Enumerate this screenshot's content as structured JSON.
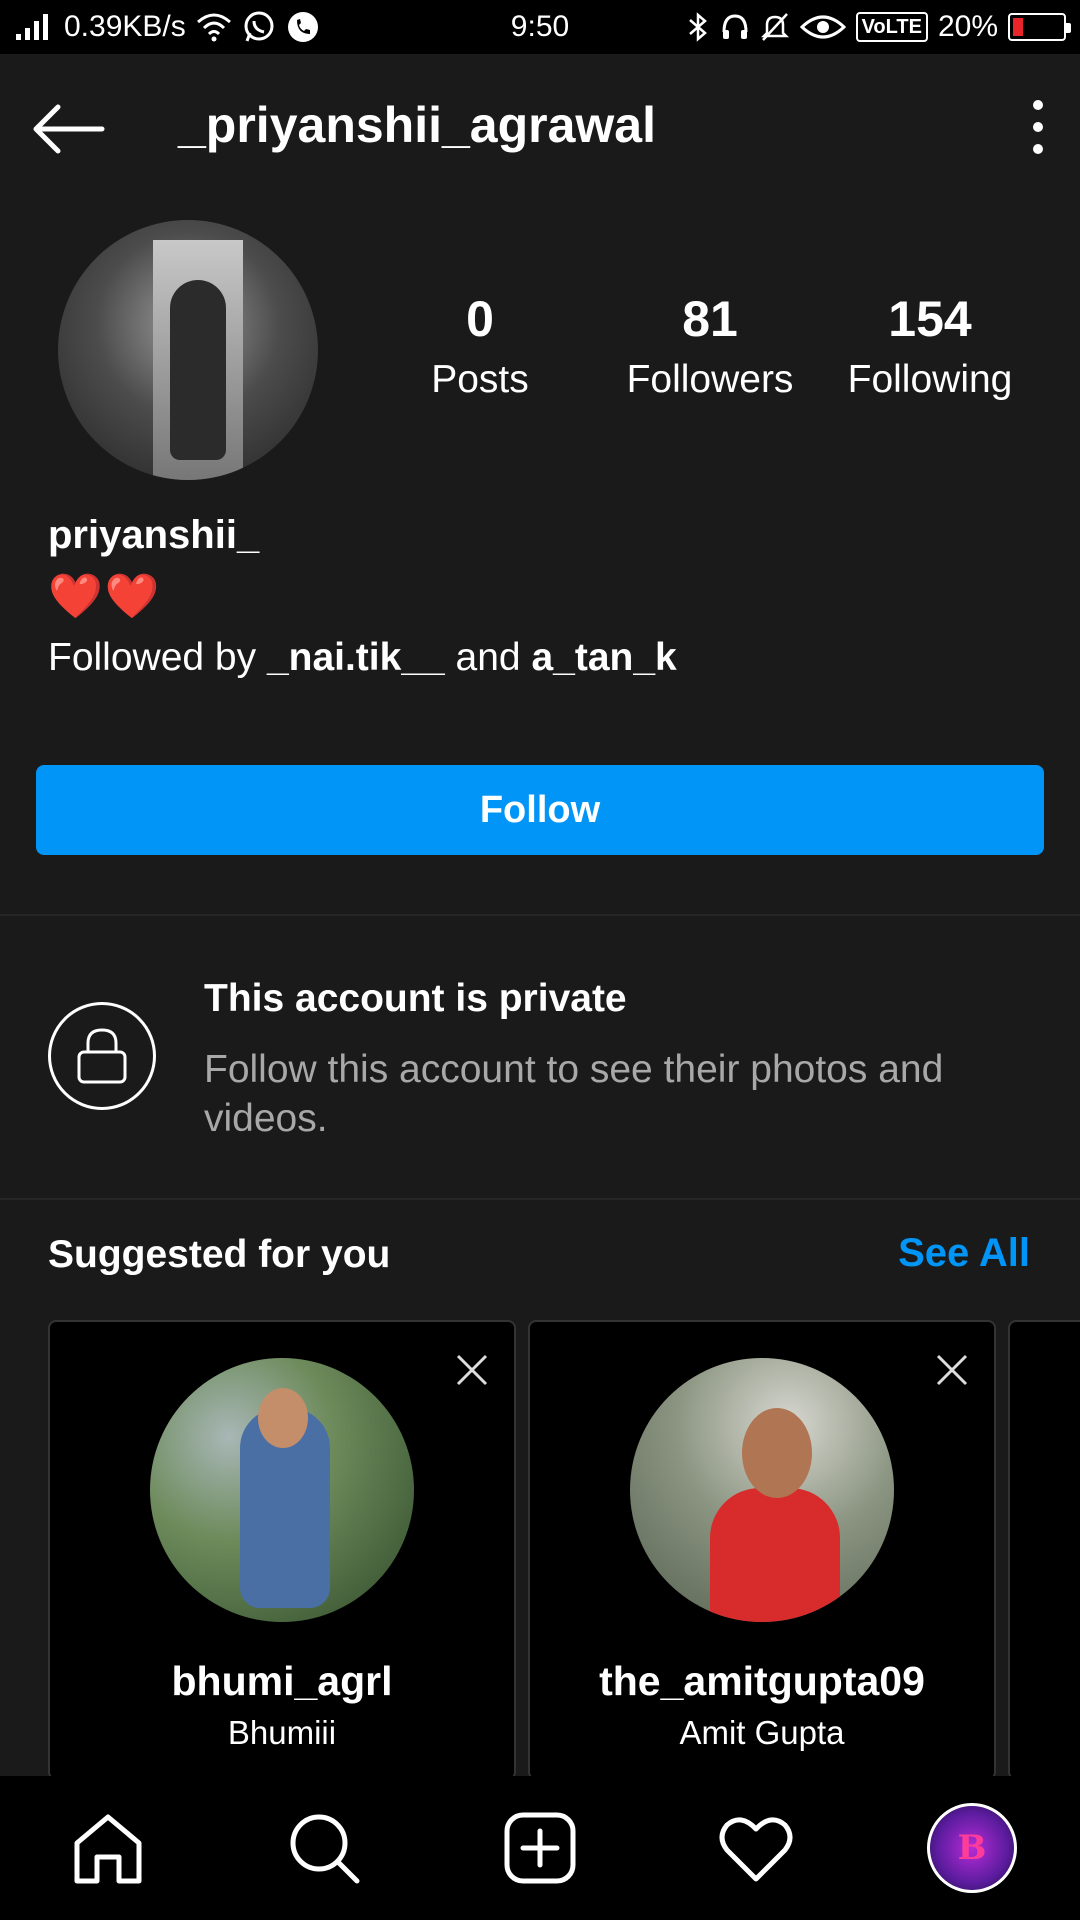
{
  "status_bar": {
    "speed": "0.39KB/s",
    "time": "9:50",
    "volte": "VoLTE",
    "battery": "20%",
    "battery_level": 0.2,
    "icons": [
      "signal-icon",
      "wifi-icon",
      "whatsapp-icon",
      "phone-call-icon",
      "bluetooth-icon",
      "headphones-icon",
      "bell-muted-icon",
      "eye-icon",
      "battery-icon"
    ]
  },
  "header": {
    "username": "_priyanshii_agrawal",
    "back_icon": "back-arrow-icon",
    "menu_icon": "more-vertical-icon"
  },
  "profile": {
    "stats": [
      {
        "value": "0",
        "label": "Posts"
      },
      {
        "value": "81",
        "label": "Followers"
      },
      {
        "value": "154",
        "label": "Following"
      }
    ],
    "display_name": "priyanshii_",
    "bio": "❤️❤️",
    "followed_by_prefix": "Followed by ",
    "followed_by_user1": "_nai.tik__",
    "followed_by_and": " and ",
    "followed_by_user2": "a_tan_k",
    "follow_label": "Follow"
  },
  "private": {
    "title": "This account is private",
    "description": "Follow this account to see their photos and videos."
  },
  "suggested": {
    "title": "Suggested for you",
    "see_all": "See All",
    "cards": [
      {
        "username": "bhumi_agrl",
        "name": "Bhumiii"
      },
      {
        "username": "the_amitgupta09",
        "name": "Amit Gupta"
      }
    ]
  },
  "nav": {
    "items": [
      "home-icon",
      "search-icon",
      "add-post-icon",
      "heart-icon",
      "profile-avatar"
    ],
    "avatar_letter": "B"
  },
  "colors": {
    "background": "#1a1a1a",
    "accent": "#0095f6",
    "muted_text": "#a8a8a8"
  }
}
